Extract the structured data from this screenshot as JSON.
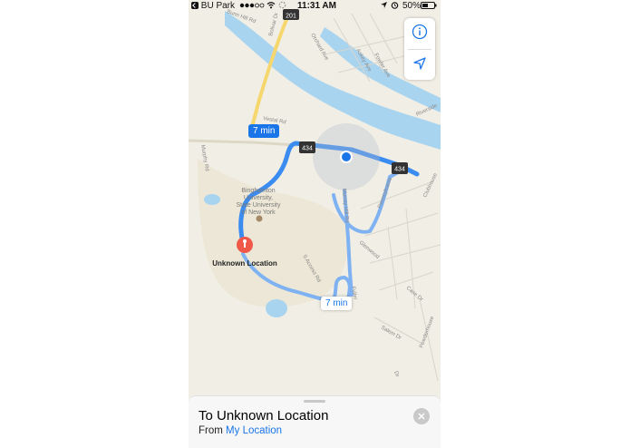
{
  "status_bar": {
    "back_app": "BU Park",
    "time": "11:31 AM",
    "battery": "50%"
  },
  "map": {
    "route_times": {
      "main": "7 min",
      "alt": "7 min"
    },
    "shields": [
      "201",
      "434",
      "434"
    ],
    "campus_label": [
      "Binghamton",
      "University,",
      "State University",
      "of New York"
    ],
    "destination_label": "Unknown Location",
    "streets": {
      "bunn_hill": "Bunn Hill Rd",
      "bolivar": "Bolivar Dr",
      "orchard": "Orchard Ave",
      "askey": "Askey Ave",
      "fowler": "Fowler Ave",
      "riverside": "Riverside",
      "vestal": "Vestal Rd",
      "murray_hill": "Murray Hill Rd",
      "pennsylvania": "Pennsylvania",
      "glenwood": "Glenwood",
      "clubhouse": "Clubhouse",
      "murphy": "Murphy Rd",
      "s_access": "S Access Rd",
      "fuller": "Fuller",
      "case": "Case Dr",
      "salem": "Salem Dr",
      "powderhouse": "Powderhouse",
      "drive": "Dr"
    },
    "colors": {
      "route": "#3b8cf0",
      "water": "#a8d4f0",
      "highway": "#f5d76e",
      "user_dot": "#1a75e8"
    }
  },
  "bottom_sheet": {
    "title": "To Unknown Location",
    "from_prefix": "From",
    "from_link": "My Location"
  }
}
